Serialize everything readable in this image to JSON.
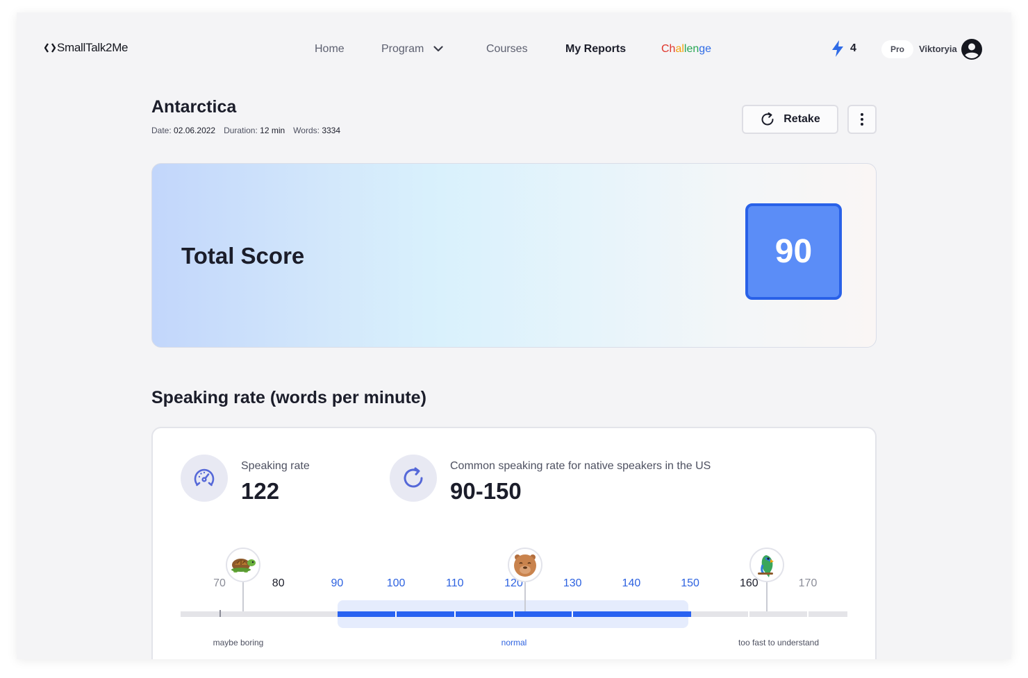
{
  "brand": {
    "name": "SmallTalk2Me"
  },
  "nav": {
    "items": [
      {
        "label": "Home"
      },
      {
        "label": "Program"
      },
      {
        "label": "Courses"
      },
      {
        "label": "My Reports"
      }
    ],
    "challenge": {
      "parts": [
        "Ch",
        "al",
        "len",
        "ge"
      ],
      "colors": [
        "#e0352b",
        "#f2a20c",
        "#27a653",
        "#2f6be6"
      ]
    }
  },
  "user": {
    "streak_count": "4",
    "plan": "Pro",
    "name": "Viktoryia"
  },
  "report": {
    "title": "Antarctica",
    "date_label": "Date:",
    "date": "02.06.2022",
    "duration_label": "Duration:",
    "duration": "12 min",
    "words_label": "Words:",
    "words": "3334",
    "retake_label": "Retake"
  },
  "total_score": {
    "label": "Total Score",
    "value": "90"
  },
  "speaking_rate_section": {
    "title": "Speaking rate (words per minute)",
    "user_rate": {
      "label": "Speaking rate",
      "value": "122"
    },
    "native_rate": {
      "label": "Common speaking rate for native speakers in the US",
      "value": "90-150"
    },
    "scale": {
      "ticks": [
        {
          "label": "70",
          "color": "grey"
        },
        {
          "label": "80",
          "color": "dark"
        },
        {
          "label": "90",
          "color": "blue"
        },
        {
          "label": "100",
          "color": "blue"
        },
        {
          "label": "110",
          "color": "blue"
        },
        {
          "label": "120",
          "color": "blue"
        },
        {
          "label": "130",
          "color": "blue"
        },
        {
          "label": "140",
          "color": "blue"
        },
        {
          "label": "150",
          "color": "blue"
        },
        {
          "label": "160",
          "color": "dark"
        },
        {
          "label": "170",
          "color": "grey"
        }
      ],
      "normal_range": [
        90,
        150
      ],
      "markers": [
        {
          "name": "turtle",
          "value": 74
        },
        {
          "name": "capybara",
          "value": 122
        },
        {
          "name": "parrot",
          "value": 163
        }
      ],
      "zones": [
        {
          "label": "maybe boring"
        },
        {
          "label": "normal"
        },
        {
          "label": "too fast to understand"
        }
      ]
    }
  },
  "colors": {
    "accent": "#2962f1",
    "score_box": "#5b8df7",
    "background": "#f4f4f6"
  }
}
